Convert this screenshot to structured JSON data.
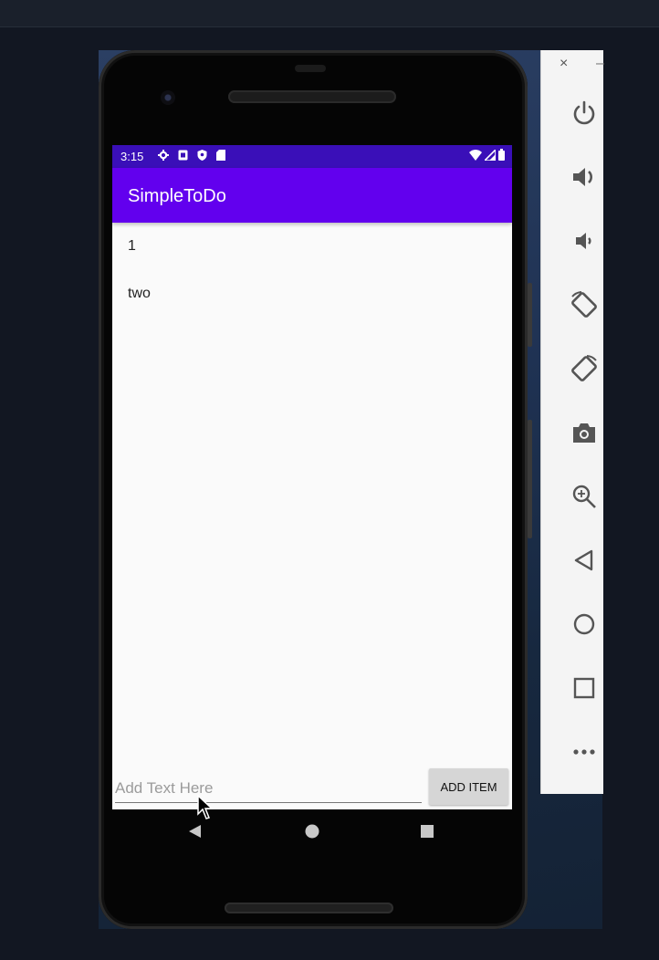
{
  "status_bar": {
    "time": "3:15",
    "icons": [
      "settings-icon",
      "sim-icon",
      "shield-icon",
      "sd-card-icon"
    ],
    "right_icons": [
      "wifi-icon",
      "signal-icon",
      "battery-icon"
    ]
  },
  "app_bar": {
    "title": "SimpleToDo"
  },
  "list": {
    "items": [
      "1",
      "two"
    ]
  },
  "input": {
    "placeholder": "Add Text Here",
    "value": ""
  },
  "add_button": {
    "label": "ADD ITEM"
  },
  "nav_bar": [
    "back-icon",
    "home-icon",
    "recents-icon"
  ],
  "side_panel": {
    "close_label": "×",
    "minimize_label": "–",
    "buttons": [
      "power-icon",
      "volume-up-icon",
      "volume-down-icon",
      "rotate-left-icon",
      "rotate-right-icon",
      "camera-icon",
      "zoom-icon",
      "back-icon",
      "home-icon",
      "overview-icon",
      "more-icon"
    ]
  },
  "colors": {
    "status_bar": "#3a0fb8",
    "app_bar": "#6200ee",
    "background": "#121722",
    "screen": "#fafafa"
  }
}
